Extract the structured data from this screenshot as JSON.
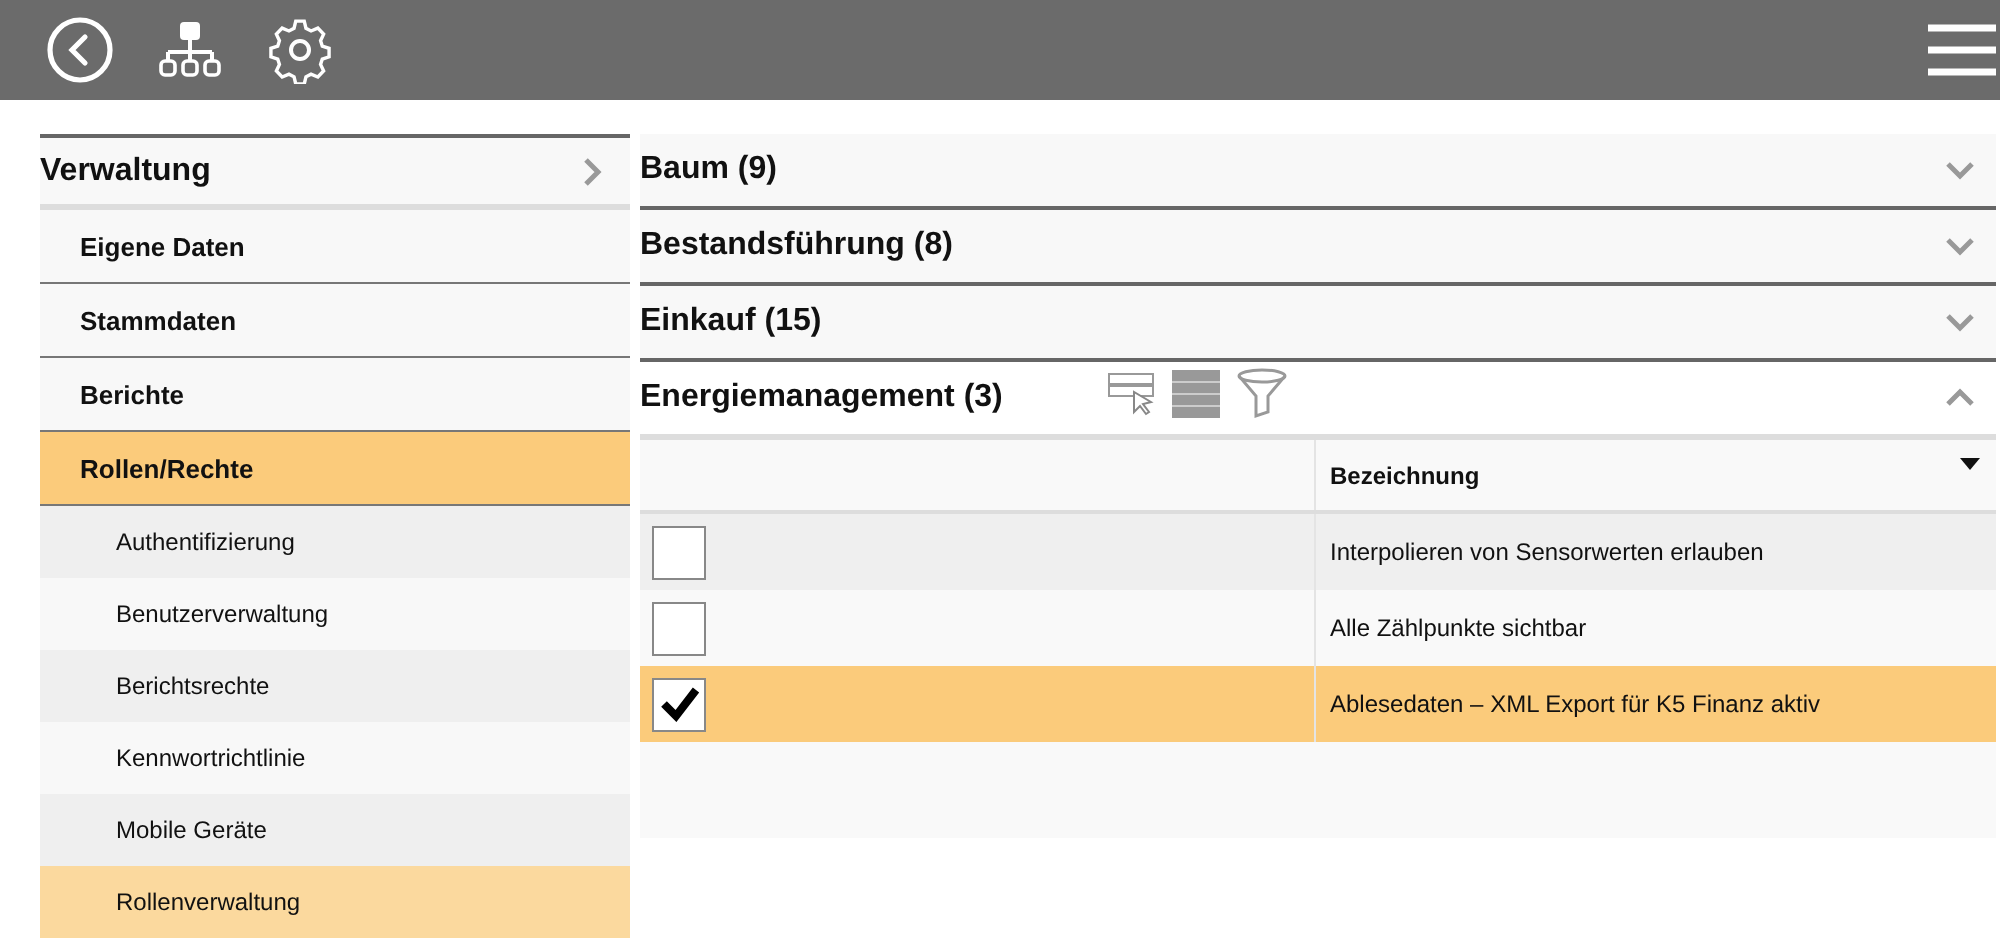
{
  "sidebar": {
    "title": "Verwaltung",
    "items": [
      {
        "label": "Eigene Daten",
        "selected": false
      },
      {
        "label": "Stammdaten",
        "selected": false
      },
      {
        "label": "Berichte",
        "selected": false
      },
      {
        "label": "Rollen/Rechte",
        "selected": true,
        "children": [
          {
            "label": "Authentifizierung",
            "selected": false
          },
          {
            "label": "Benutzerverwaltung",
            "selected": false
          },
          {
            "label": "Berichtsrechte",
            "selected": false
          },
          {
            "label": "Kennwortrichtlinie",
            "selected": false
          },
          {
            "label": "Mobile Geräte",
            "selected": false
          },
          {
            "label": "Rollenverwaltung",
            "selected": true
          }
        ]
      }
    ]
  },
  "sections": [
    {
      "title": "Baum (9)",
      "expanded": false
    },
    {
      "title": "Bestandsführung (8)",
      "expanded": false
    },
    {
      "title": "Einkauf (15)",
      "expanded": false
    },
    {
      "title": "Energiemanagement (3)",
      "expanded": true,
      "table": {
        "columns": [
          "Bezeichnung"
        ],
        "rows": [
          {
            "checked": false,
            "selected": false,
            "label": "Interpolieren von Sensorwerten erlauben"
          },
          {
            "checked": false,
            "selected": false,
            "label": "Alle Zählpunkte sichtbar"
          },
          {
            "checked": true,
            "selected": true,
            "label": "Ablesedaten – XML Export für K5 Finanz aktiv"
          }
        ]
      }
    }
  ]
}
